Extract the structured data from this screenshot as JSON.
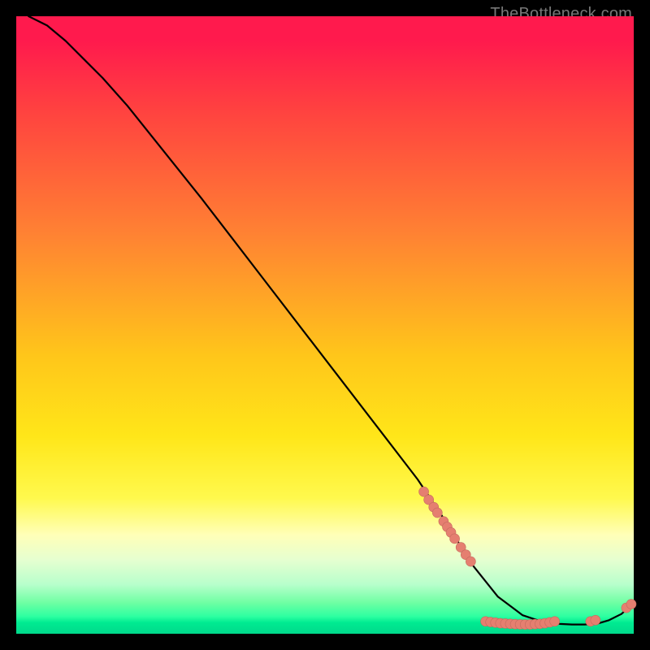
{
  "watermark": "TheBottleneck.com",
  "colors": {
    "curve": "#000000",
    "dot_fill": "#e57f70",
    "dot_stroke": "#c46a5d"
  },
  "chart_data": {
    "type": "line",
    "title": "",
    "xlabel": "",
    "ylabel": "",
    "xlim": [
      0,
      100
    ],
    "ylim": [
      0,
      100
    ],
    "grid": false,
    "legend": false,
    "series": [
      {
        "name": "curve",
        "x": [
          2,
          5,
          8,
          11,
          14,
          18,
          22,
          26,
          30,
          35,
          40,
          45,
          50,
          55,
          60,
          65,
          67,
          69,
          70.5,
          72,
          74,
          78,
          82,
          85,
          88,
          90,
          92,
          94,
          96,
          98,
          100
        ],
        "y": [
          100,
          98.5,
          96,
          93,
          90,
          85.5,
          80.5,
          75.5,
          70.5,
          64,
          57.5,
          51,
          44.5,
          38,
          31.5,
          25,
          22,
          19,
          17,
          14,
          11,
          6,
          3,
          2,
          1.6,
          1.5,
          1.5,
          1.6,
          2.2,
          3.2,
          5
        ]
      }
    ],
    "dots": [
      {
        "x": 66.0,
        "y": 23.0
      },
      {
        "x": 66.8,
        "y": 21.7
      },
      {
        "x": 67.6,
        "y": 20.5
      },
      {
        "x": 68.2,
        "y": 19.6
      },
      {
        "x": 69.2,
        "y": 18.2
      },
      {
        "x": 69.8,
        "y": 17.3
      },
      {
        "x": 70.4,
        "y": 16.4
      },
      {
        "x": 71.0,
        "y": 15.4
      },
      {
        "x": 72.0,
        "y": 14.0
      },
      {
        "x": 72.8,
        "y": 12.8
      },
      {
        "x": 73.6,
        "y": 11.7
      },
      {
        "x": 76.0,
        "y": 2.0
      },
      {
        "x": 76.8,
        "y": 1.9
      },
      {
        "x": 77.6,
        "y": 1.8
      },
      {
        "x": 78.4,
        "y": 1.7
      },
      {
        "x": 79.2,
        "y": 1.65
      },
      {
        "x": 80.0,
        "y": 1.6
      },
      {
        "x": 80.8,
        "y": 1.55
      },
      {
        "x": 81.6,
        "y": 1.52
      },
      {
        "x": 82.4,
        "y": 1.5
      },
      {
        "x": 83.2,
        "y": 1.5
      },
      {
        "x": 84.0,
        "y": 1.55
      },
      {
        "x": 84.8,
        "y": 1.6
      },
      {
        "x": 85.6,
        "y": 1.7
      },
      {
        "x": 86.4,
        "y": 1.85
      },
      {
        "x": 87.2,
        "y": 2.0
      },
      {
        "x": 93.0,
        "y": 2.0
      },
      {
        "x": 93.8,
        "y": 2.2
      },
      {
        "x": 98.8,
        "y": 4.2
      },
      {
        "x": 99.6,
        "y": 4.8
      }
    ]
  }
}
